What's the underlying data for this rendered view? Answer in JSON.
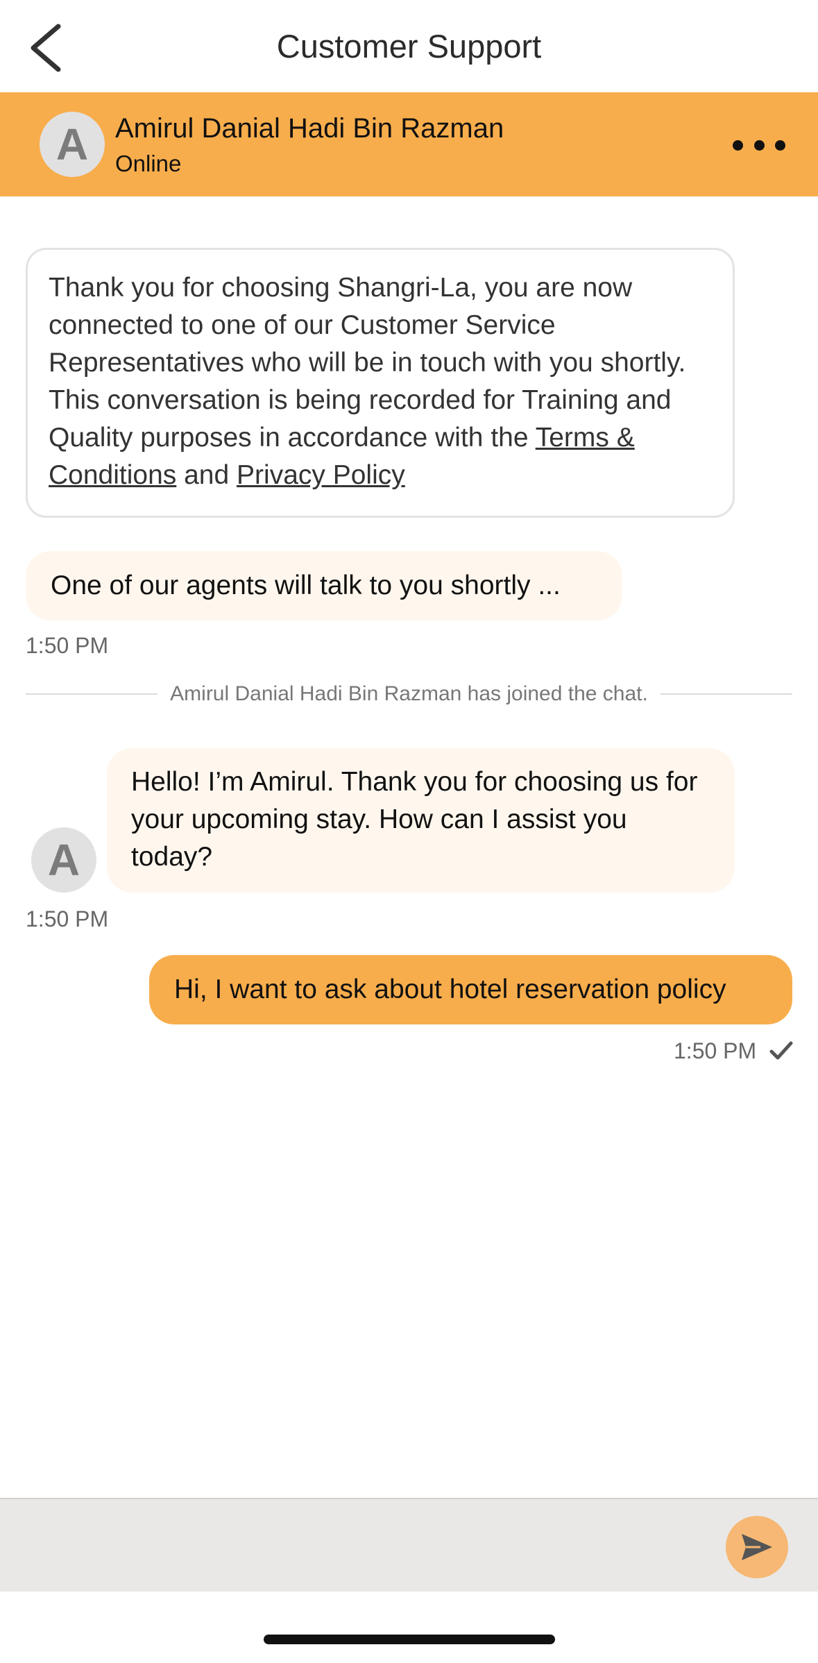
{
  "nav": {
    "title": "Customer Support",
    "back_icon": "chevron-left-icon"
  },
  "agent": {
    "initial": "A",
    "name": "Amirul Danial Hadi Bin Razman",
    "status": "Online",
    "more_icon": "more-horizontal-icon"
  },
  "consent": {
    "text_part1": "Thank you for choosing Shangri-La, you are now connected to one of our Customer Service Representatives who will be in touch with you shortly. This conversation is being recorded for Training and Quality purposes in accordance with the ",
    "terms_link": "Terms & Conditions",
    "text_and": " and ",
    "privacy_link": "Privacy Policy"
  },
  "messages": [
    {
      "sender": "bot",
      "text": "One of our agents will talk to you shortly ...",
      "time": "1:50 PM"
    },
    {
      "sender": "system",
      "text": "Amirul Danial Hadi Bin Razman has joined the chat."
    },
    {
      "sender": "agent",
      "avatar_initial": "A",
      "text": "Hello! I’m Amirul. Thank you for choosing us for your upcoming stay. How can I assist you today?",
      "time": "1:50 PM"
    },
    {
      "sender": "user",
      "text": "Hi, I want to ask about hotel reservation policy",
      "time": "1:50 PM",
      "status_icon": "check-icon"
    }
  ],
  "composer": {
    "value": "",
    "placeholder": "",
    "send_icon": "send-icon"
  },
  "colors": {
    "accent": "#f8ad4c",
    "incoming_bubble": "#fff7ee",
    "send_button": "#f6b874",
    "composer_bg": "#e9e8e6"
  }
}
